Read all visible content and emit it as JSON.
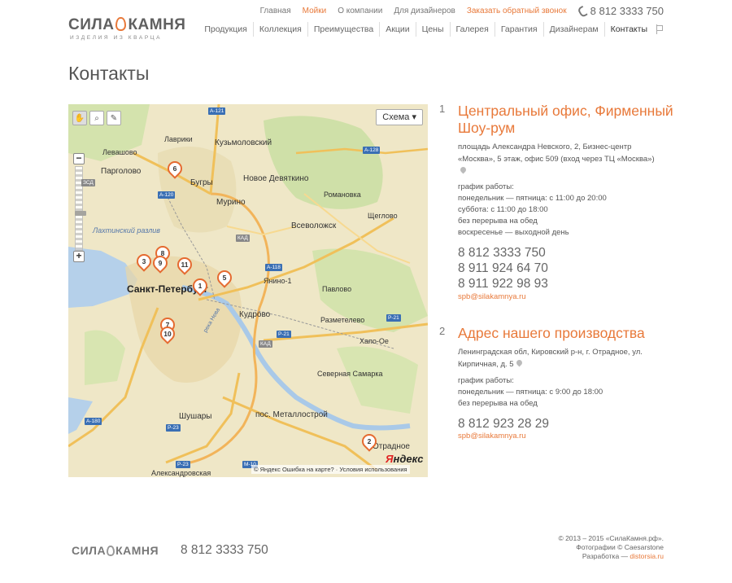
{
  "brand": {
    "logo_text_left": "СИЛА",
    "logo_text_right": "КАМНЯ",
    "logo_sub": "ИЗДЕЛИЯ ИЗ КВАРЦА"
  },
  "topnav": {
    "items": [
      "Главная",
      "Мойки",
      "О компании",
      "Для дизайнеров",
      "Заказать обратный звонок"
    ],
    "phone": "8 812 3333 750",
    "colors": {
      "accent": "#e8793a"
    }
  },
  "mainnav": {
    "items": [
      "Продукция",
      "Коллекция",
      "Преимущества",
      "Акции",
      "Цены",
      "Галерея",
      "Гарантия",
      "Дизайнерам",
      "Контакты"
    ]
  },
  "page": {
    "title": "Контакты"
  },
  "map": {
    "scheme_label": "Схема ▾",
    "labels": {
      "kuzmolovsky": "Кузьмоловский",
      "lavriki": "Лаврики",
      "levashovo": "Левашово",
      "pargolovo": "Парголово",
      "bugry": "Бугры",
      "novoe_devyatkino": "Новое Девяткино",
      "romanovka": "Романовка",
      "shcheglovo": "Щеглово",
      "murino": "Мурино",
      "vsevolozhsk": "Всеволожск",
      "lakhtinsky": "Лахтинский разлив",
      "spb": "Санкт-Петербург",
      "yanino": "Янино-1",
      "pavlovo": "Павлово",
      "kudrovo": "Кудрово",
      "razmetelevo": "Разметелево",
      "khapo_oe": "Хапо-Ое",
      "severnaya_samarka": "Северная Самарка",
      "shushary": "Шушары",
      "metallostroy": "пос. Металлострой",
      "aleksandrovskaya": "Александровская",
      "otradnoe": "Отрадное",
      "neva": "река Нева"
    },
    "roads": [
      "А-121",
      "А-120",
      "А-128",
      "А-118",
      "Р-21",
      "Р-21",
      "М-10",
      "Р-23",
      "А-180",
      "Р-23",
      "КАД",
      "КАД",
      "ЗСД"
    ],
    "pins": [
      "1",
      "2",
      "3",
      "5",
      "6",
      "7",
      "8",
      "9",
      "10",
      "11"
    ],
    "copyright": "© Яндекс",
    "error_link": "Ошибка на карте?",
    "terms_link": "Условия использования",
    "yandex": "Яндекс"
  },
  "offices": [
    {
      "num": "1",
      "name": "Центральный офис, Фирменный Шоу-рум",
      "address": "площадь Александра Невского, 2, Бизнес-центр «Москва», 5 этаж, офис 509 (вход через ТЦ «Москва»)",
      "hours": [
        "график работы:",
        "понедельник — пятница: с 11:00 до 20:00",
        "суббота: с 11:00 до 18:00",
        "без перерыва на обед",
        "воскресенье — выходной день"
      ],
      "phones": [
        "8 812 3333 750",
        "8 911 924 64 70",
        "8 911 922 98 93"
      ],
      "email": "spb@silakamnya.ru"
    },
    {
      "num": "2",
      "name": "Адрес нашего производства",
      "address": "Ленинградская обл, Кировский р-н, г. Отрадное, ул. Кирпичная, д. 5",
      "hours": [
        "график работы:",
        "понедельник — пятница: с 9:00 до 18:00",
        "без перерыва на обед"
      ],
      "phones": [
        "8 812 923 28 29"
      ],
      "email": "spb@silakamnya.ru"
    }
  ],
  "footer": {
    "logo_left": "СИЛА",
    "logo_right": "КАМНЯ",
    "phone": "8 812 3333 750",
    "copyright": "© 2013 – 2015 «СилаКамня.рф».",
    "photos": "Фотографии © Caesarstone",
    "dev_label": "Разработка —",
    "dev_link": "distorsia.ru"
  }
}
